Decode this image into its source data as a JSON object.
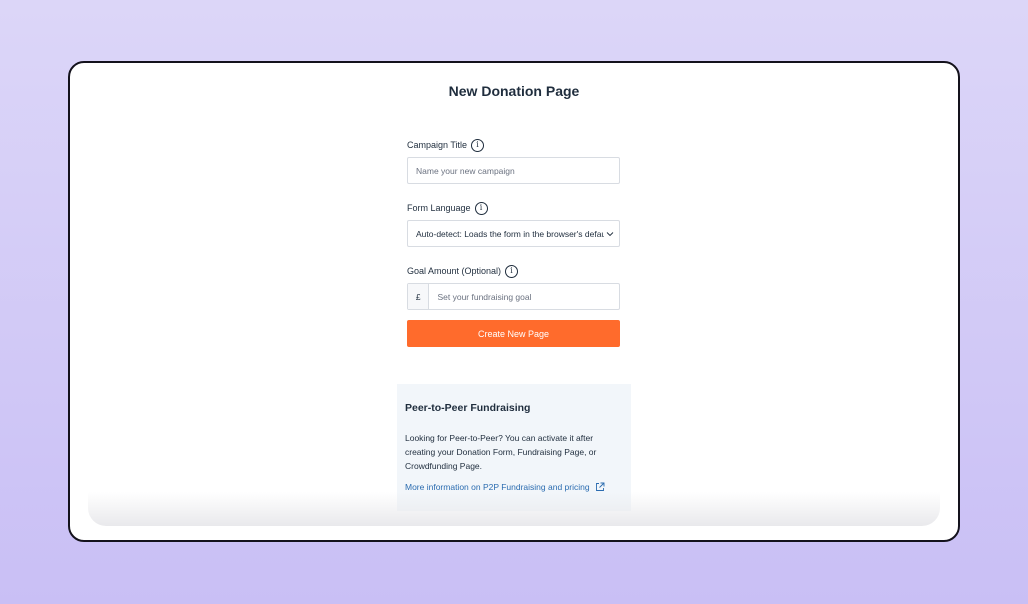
{
  "page": {
    "title": "New Donation Page"
  },
  "form": {
    "campaign_title": {
      "label": "Campaign Title",
      "placeholder": "Name your new campaign"
    },
    "form_language": {
      "label": "Form Language",
      "value": "Auto-detect: Loads the form in the browser's default language"
    },
    "goal_amount": {
      "label": "Goal Amount (Optional)",
      "currency": "£",
      "placeholder": "Set your fundraising goal"
    },
    "info_glyph": "i",
    "submit_label": "Create New Page"
  },
  "p2p": {
    "title": "Peer-to-Peer Fundraising",
    "text": "Looking for Peer-to-Peer? You can activate it after creating your Donation Form, Fundraising Page, or Crowdfunding Page.",
    "link_label": "More information on P2P Fundraising and pricing"
  },
  "colors": {
    "accent": "#ff6b2c",
    "link": "#2b6cb0",
    "panel": "#f2f6fa",
    "text": "#1f2d3d"
  },
  "icons": [
    "info-icon",
    "chevron-down-icon",
    "external-link-icon"
  ]
}
